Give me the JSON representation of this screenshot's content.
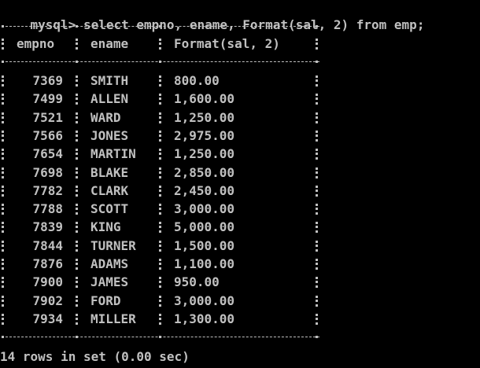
{
  "terminal": {
    "prompt": "mysql>",
    "command": "select empno, ename, Format(sal, 2) from emp;",
    "status": "14 rows in set (0.00 sec)"
  },
  "table": {
    "columns": [
      "empno",
      "ename",
      "Format(sal, 2)"
    ],
    "rows": [
      [
        "7369",
        "SMITH",
        "800.00"
      ],
      [
        "7499",
        "ALLEN",
        "1,600.00"
      ],
      [
        "7521",
        "WARD",
        "1,250.00"
      ],
      [
        "7566",
        "JONES",
        "2,975.00"
      ],
      [
        "7654",
        "MARTIN",
        "1,250.00"
      ],
      [
        "7698",
        "BLAKE",
        "2,850.00"
      ],
      [
        "7782",
        "CLARK",
        "2,450.00"
      ],
      [
        "7788",
        "SCOTT",
        "3,000.00"
      ],
      [
        "7839",
        "KING",
        "5,000.00"
      ],
      [
        "7844",
        "TURNER",
        "1,500.00"
      ],
      [
        "7876",
        "ADAMS",
        "1,100.00"
      ],
      [
        "7900",
        "JAMES",
        "950.00"
      ],
      [
        "7902",
        "FORD",
        "3,000.00"
      ],
      [
        "7934",
        "MILLER",
        "1,300.00"
      ]
    ]
  }
}
